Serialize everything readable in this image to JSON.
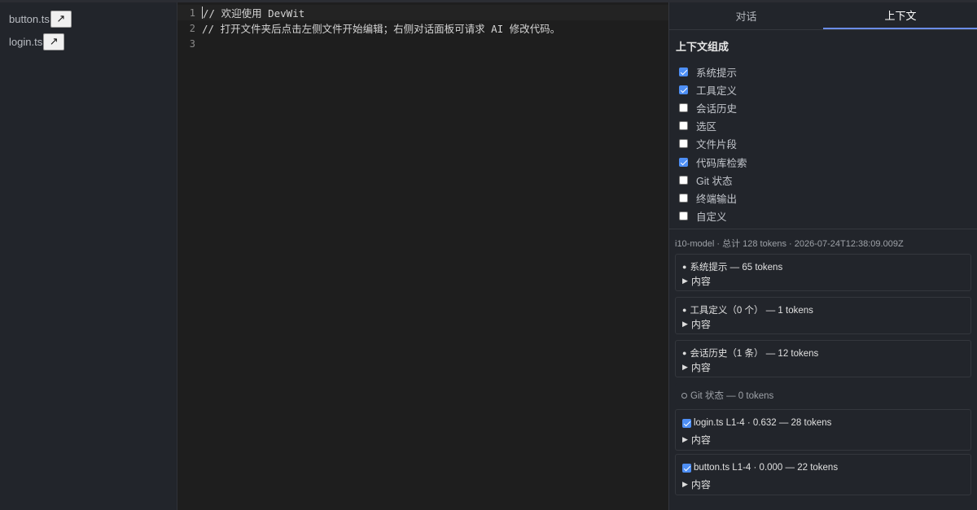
{
  "sidebar": {
    "files": [
      {
        "name": "button.ts",
        "open_icon": "↗"
      },
      {
        "name": "login.ts",
        "open_icon": "↗"
      }
    ]
  },
  "editor": {
    "lines": [
      {
        "number": "1",
        "text": "// 欢迎使用 DevWit"
      },
      {
        "number": "2",
        "text": "// 打开文件夹后点击左侧文件开始编辑；右侧对话面板可请求 AI 修改代码。"
      },
      {
        "number": "3",
        "text": ""
      }
    ]
  },
  "panel": {
    "tabs": [
      {
        "label": "对话",
        "active": false
      },
      {
        "label": "上下文",
        "active": true
      }
    ],
    "section_title": "上下文组成",
    "options": [
      {
        "label": "系统提示",
        "checked": true
      },
      {
        "label": "工具定义",
        "checked": true
      },
      {
        "label": "会话历史",
        "checked": false
      },
      {
        "label": "选区",
        "checked": false
      },
      {
        "label": "文件片段",
        "checked": false
      },
      {
        "label": "代码库检索",
        "checked": true
      },
      {
        "label": "Git 状态",
        "checked": false
      },
      {
        "label": "终端输出",
        "checked": false
      },
      {
        "label": "自定义",
        "checked": false
      }
    ],
    "meta": "i10-model · 总计 128 tokens · 2026-07-24T12:38:09.009Z",
    "cards": [
      {
        "head": "系统提示 — 65 tokens",
        "marker": "bullet",
        "toggle": "内容"
      },
      {
        "head": "工具定义（0 个） — 1 tokens",
        "marker": "bullet",
        "toggle": "内容"
      },
      {
        "head": "会话历史（1 条） — 12 tokens",
        "marker": "bullet",
        "toggle": "内容"
      },
      {
        "head": "Git 状态 — 0 tokens",
        "marker": "ring",
        "toggle": ""
      },
      {
        "head": "login.ts L1-4 · 0.632 — 28 tokens",
        "marker": "checkbox",
        "toggle": "内容"
      },
      {
        "head": "button.ts L1-4 · 0.000 — 22 tokens",
        "marker": "checkbox",
        "toggle": "内容"
      }
    ],
    "colors": {
      "accent": "#6b8de8",
      "checkbox": "#4e8ff5"
    }
  }
}
